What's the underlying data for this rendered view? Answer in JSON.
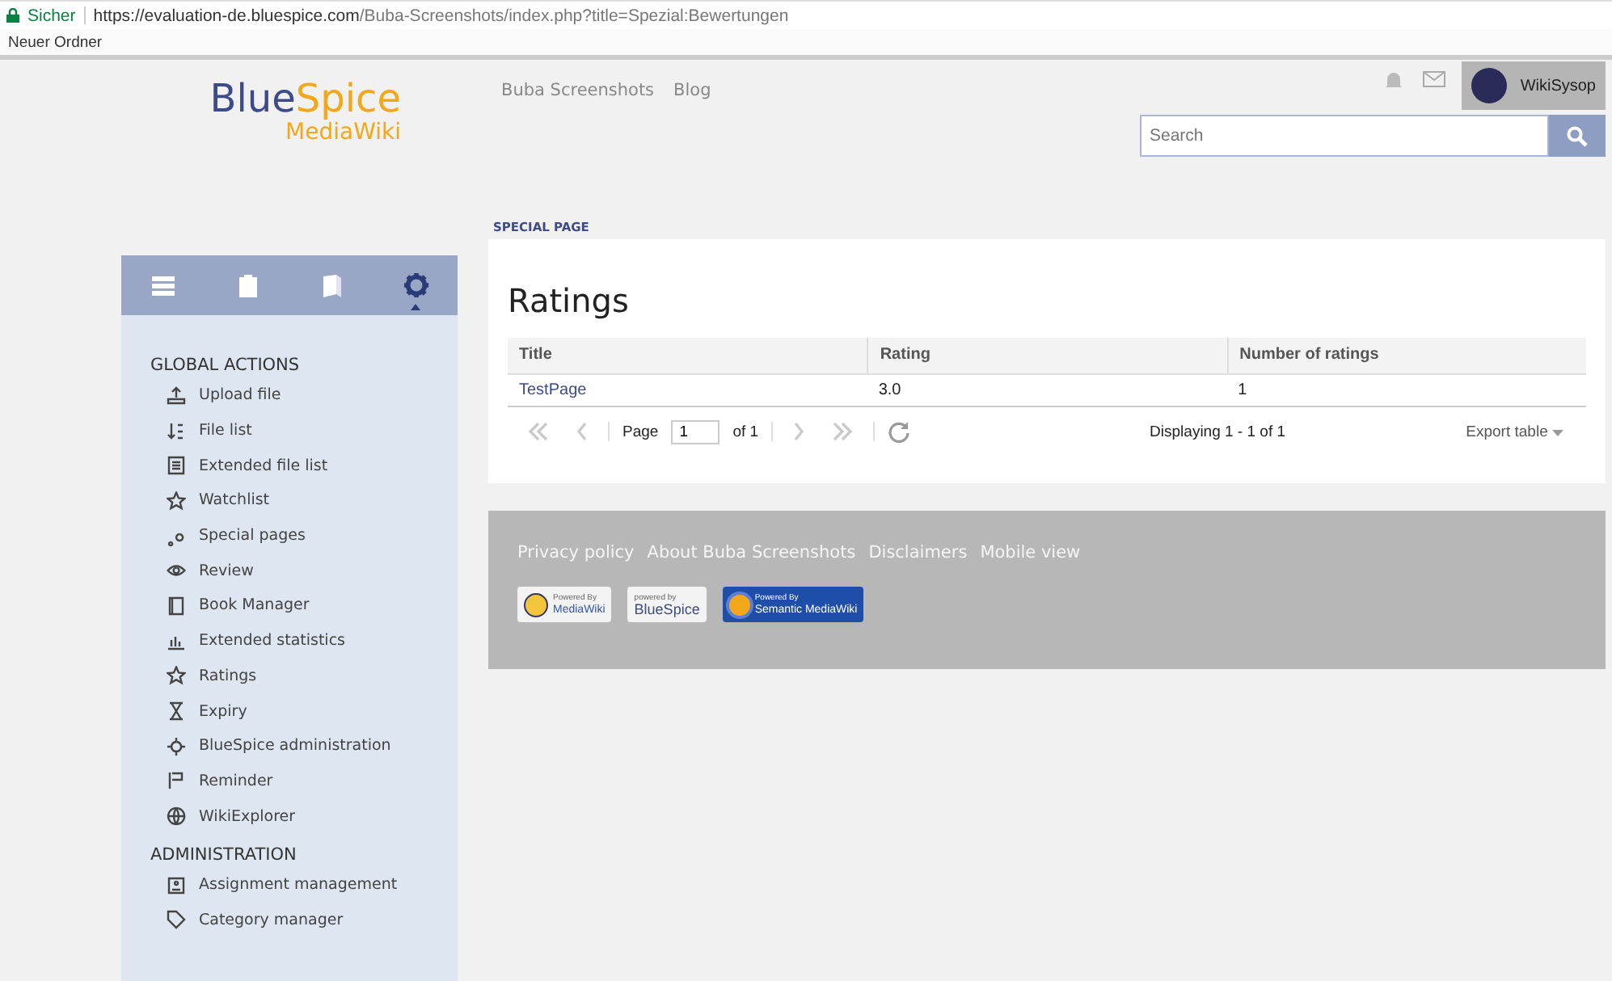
{
  "browser": {
    "secure_label": "Sicher",
    "url_host": "https://evaluation-de.bluespice.com",
    "url_path": "/Buba-Screenshots/index.php?title=Spezial:Bewertungen",
    "bookmarks": [
      "Neuer Ordner"
    ]
  },
  "logo": {
    "brand_a": "Blue",
    "brand_b": "Spice",
    "sub": "MediaWiki"
  },
  "top_links": [
    "Buba Screenshots",
    "Blog"
  ],
  "user": {
    "name": "WikiSysop"
  },
  "search": {
    "placeholder": "Search"
  },
  "sidebar_tabs": [
    {
      "selected": false
    },
    {
      "selected": false
    },
    {
      "selected": false
    },
    {
      "selected": true
    }
  ],
  "sidebar_sections": [
    {
      "heading": "GLOBAL ACTIONS",
      "items": [
        "Upload file",
        "File list",
        "Extended file list",
        "Watchlist",
        "Special pages",
        "Review",
        "Book Manager",
        "Extended statistics",
        "Ratings",
        "Expiry",
        "BlueSpice administration",
        "Reminder",
        "WikiExplorer"
      ]
    },
    {
      "heading": "ADMINISTRATION",
      "items": [
        "Assignment management",
        "Category manager"
      ]
    }
  ],
  "breadcrumb": "SPECIAL PAGE",
  "page_title": "Ratings",
  "table": {
    "columns": [
      "Title",
      "Rating",
      "Number of ratings"
    ],
    "rows": [
      [
        "TestPage",
        "3.0",
        "1"
      ]
    ]
  },
  "pager": {
    "page_label": "Page",
    "page_value": "1",
    "of_label": "of 1",
    "first_disabled": true,
    "prev_disabled": true,
    "next_disabled": true,
    "last_disabled": true,
    "display": "Displaying 1 - 1 of 1",
    "export": "Export table"
  },
  "footer": {
    "links": [
      "Privacy policy",
      "About Buba Screenshots",
      "Disclaimers",
      "Mobile view"
    ],
    "badges": [
      {
        "kind": "mediawiki",
        "small": "Powered By",
        "big": "MediaWiki"
      },
      {
        "kind": "bluespice",
        "small": "powered by",
        "big": "BlueSpice"
      },
      {
        "kind": "smw",
        "small": "Powered By",
        "big": "Semantic MediaWiki"
      }
    ]
  }
}
